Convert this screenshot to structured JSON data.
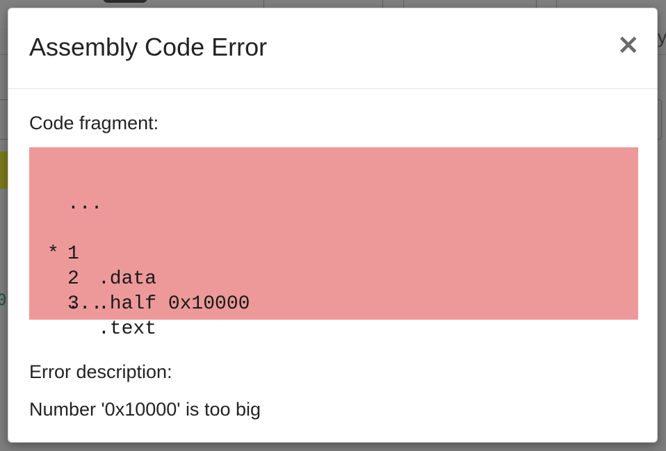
{
  "background": {
    "partial_char_left": "0",
    "partial_char_right": "y"
  },
  "modal": {
    "title": "Assembly Code Error",
    "close_symbol": "×",
    "code_fragment_label": "Code fragment:",
    "code_leading_ellipsis": "...",
    "code_lines": [
      {
        "marker": "",
        "number": "1",
        "text": ".data"
      },
      {
        "marker": "*",
        "number": "2",
        "text": ".half 0x10000"
      },
      {
        "marker": "",
        "number": "3",
        "text": ".text"
      }
    ],
    "code_trailing_ellipsis": "...",
    "error_description_label": "Error description:",
    "error_message": "Number '0x10000' is too big"
  },
  "colors": {
    "code_background": "#ee9999",
    "overlay": "#7d7d7d"
  }
}
